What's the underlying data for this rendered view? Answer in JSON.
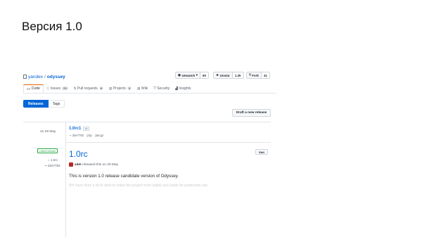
{
  "slide": {
    "title": "Версия 1.0"
  },
  "repo": {
    "owner": "yandex",
    "separator": "/",
    "name": "odyssey"
  },
  "actions": {
    "watch": {
      "label": "Unwatch",
      "caret": "▾",
      "count": "60"
    },
    "star": {
      "label": "Unstar",
      "count": "1.2k"
    },
    "fork": {
      "label": "Fork",
      "count": "41"
    }
  },
  "tabs": [
    {
      "label": "Code",
      "icon": "code-icon"
    },
    {
      "label": "Issues",
      "count": "23",
      "icon": "issue-icon"
    },
    {
      "label": "Pull requests",
      "count": "6",
      "icon": "pull-request-icon"
    },
    {
      "label": "Projects",
      "count": "0",
      "icon": "project-icon"
    },
    {
      "label": "Wiki",
      "icon": "book-icon"
    },
    {
      "label": "Security",
      "icon": "shield-icon"
    },
    {
      "label": "Insights",
      "icon": "graph-icon"
    }
  ],
  "subnav": {
    "releases": "Releases",
    "tags": "Tags"
  },
  "draft_button": "Draft a new release",
  "release1": {
    "date": "on 29 May",
    "tag": "1.0rc1",
    "dots": "•••",
    "commit": "32e7792",
    "zip": "zip",
    "targz": "tar.gz"
  },
  "release2": {
    "badge": "Latest release",
    "tag": "1.0rc",
    "commit": "32e7792",
    "title": "1.0rc",
    "edit": "Edit",
    "author": "x4m",
    "released_text": "released this on 29 May",
    "body": "This is version 1.0 release candidate version of Odyssey.",
    "fade_text": "We have done a lot of work to make the project more stable and ready for production use."
  }
}
